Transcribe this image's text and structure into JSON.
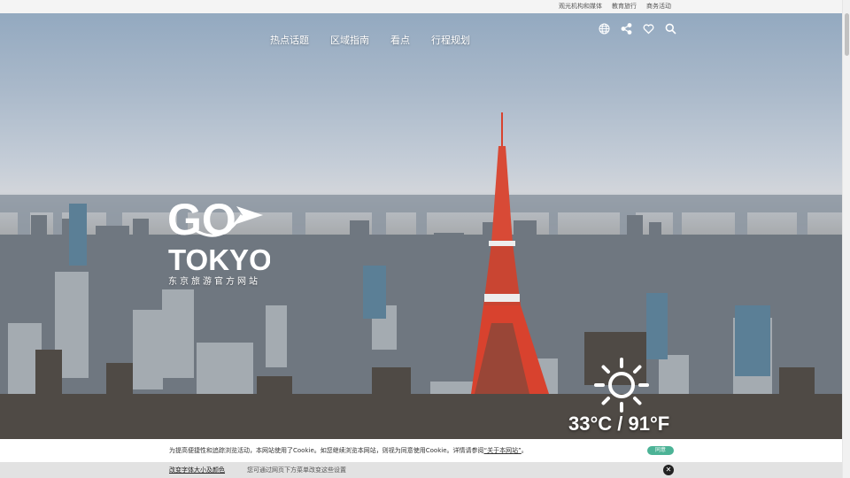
{
  "top_links": [
    "观光机构和媒体",
    "教育旅行",
    "商务活动"
  ],
  "nav": [
    "热点话题",
    "区域指南",
    "看点",
    "行程规划"
  ],
  "icons": [
    "globe-icon",
    "share-icon",
    "heart-icon",
    "search-icon"
  ],
  "logo": {
    "go": "GO",
    "tokyo": "TOKYO",
    "subtitle": "东京旅游官方网站"
  },
  "weather": {
    "icon": "sun-icon",
    "temperature": "33°C / 91°F"
  },
  "cookie": {
    "text_before": "为提高便捷性和追踪浏览活动，本网站使用了Cookie。如您继续浏览本网站，则视为同意使用Cookie。详情请参阅",
    "link": "“关于本网站”",
    "text_after": "。",
    "accept": "同意"
  },
  "font_bar": {
    "change": "改变字体大小及颜色",
    "hint": "您可通过网页下方菜单改变这些设置",
    "close": "✕"
  },
  "colors": {
    "accept": "#4cb396",
    "tower_red": "#d8422e",
    "sky_top": "#93a9c0"
  }
}
